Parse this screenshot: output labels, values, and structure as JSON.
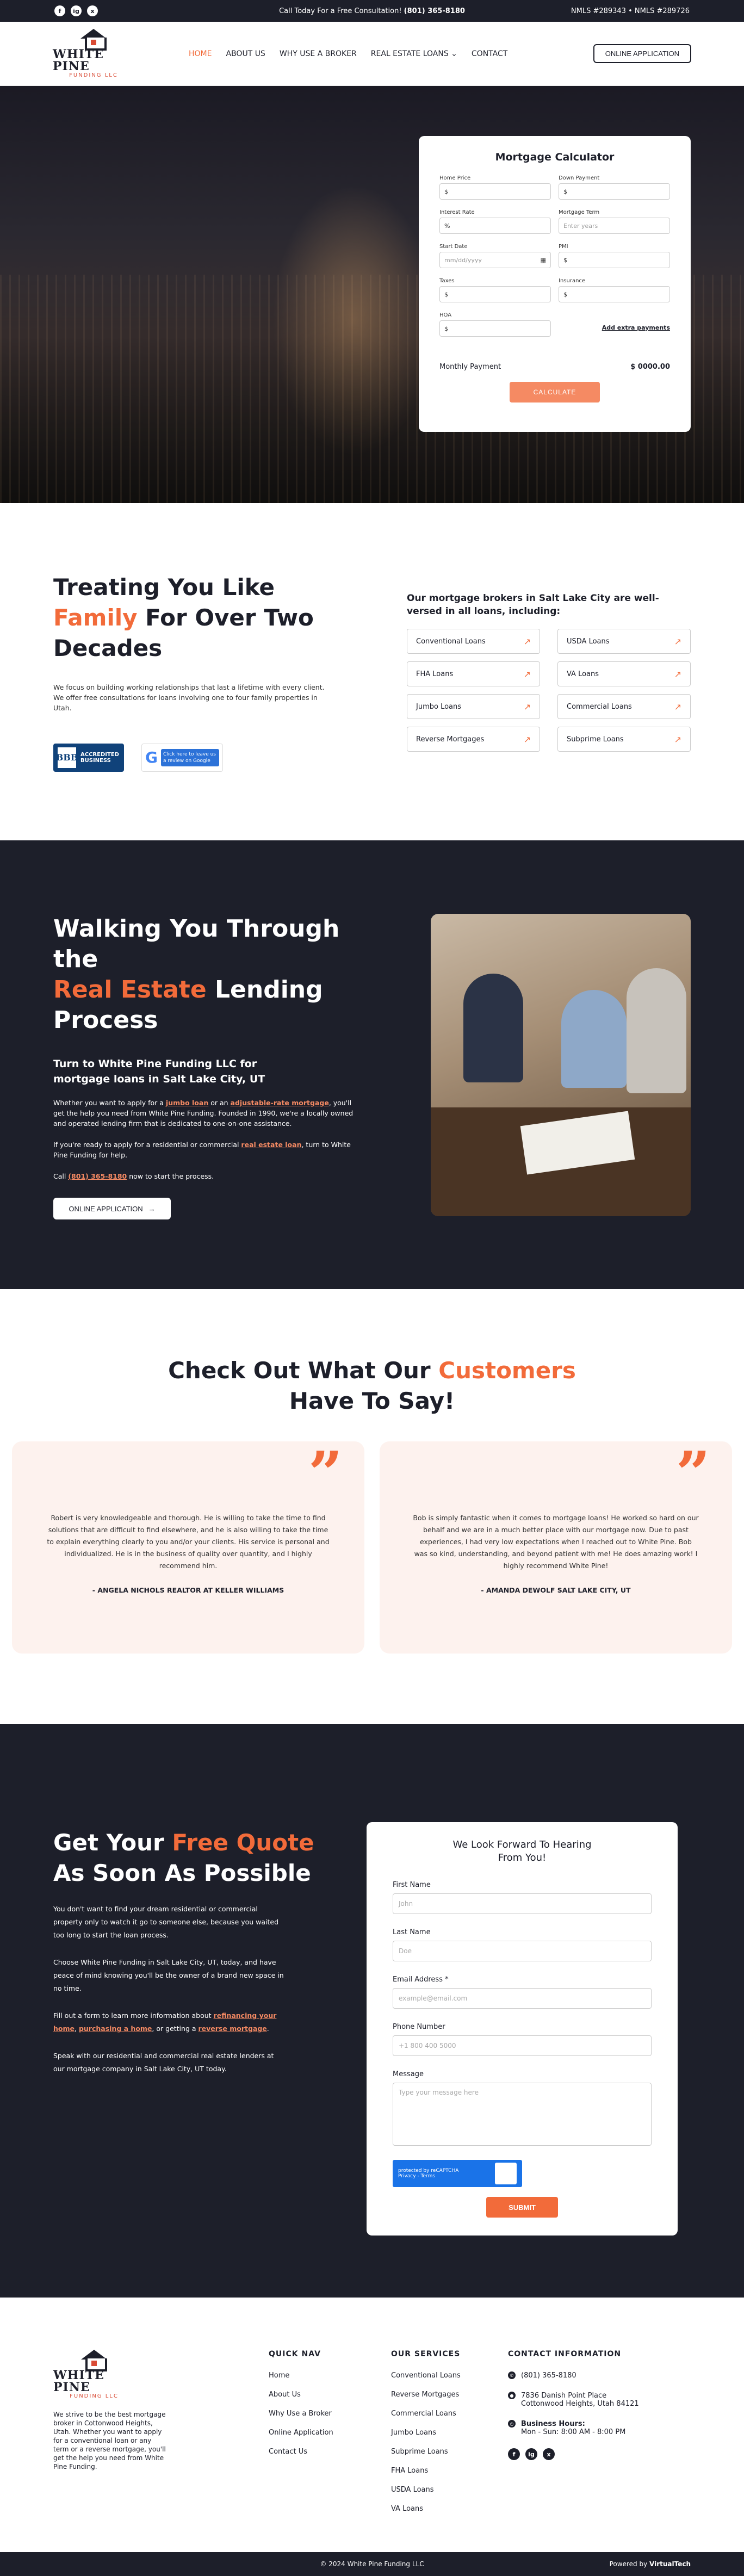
{
  "topbar": {
    "social": [
      "f",
      "ig",
      "x"
    ],
    "cta_prefix": "Call Today For a Free Consultation!",
    "phone": "(801) 365-8180",
    "nmls": "NMLS #289343 • NMLS #289726"
  },
  "header": {
    "logo_name": "WHITE PINE",
    "logo_sub": "FUNDING LLC",
    "nav": [
      "HOME",
      "ABOUT US",
      "WHY USE A BROKER",
      "REAL ESTATE LOANS",
      "CONTACT"
    ],
    "cta": "ONLINE APPLICATION"
  },
  "calculator": {
    "title": "Mortgage Calculator",
    "fields": [
      {
        "label": "Home Price",
        "value": "$"
      },
      {
        "label": "Down Payment",
        "value": "$"
      },
      {
        "label": "Interest Rate",
        "value": "%"
      },
      {
        "label": "Mortgage Term",
        "value": "Enter years"
      },
      {
        "label": "Start Date",
        "value": "mm/dd/yyyy"
      },
      {
        "label": "PMI",
        "value": "$"
      },
      {
        "label": "Taxes",
        "value": "$"
      },
      {
        "label": "Insurance",
        "value": "$"
      },
      {
        "label": "HOA",
        "value": "$"
      }
    ],
    "extra_link": "Add extra payments",
    "monthly_label": "Monthly Payment",
    "monthly_value": "$ 0000.00",
    "button": "CALCULATE"
  },
  "treating": {
    "title_1": "Treating You Like",
    "title_accent": "Family",
    "title_2": "For Over Two Decades",
    "body": "We focus on building working relationships that last a lifetime with every client. We offer free consultations for loans involving one to four family properties in Utah.",
    "bbb_text": "ACCREDITED BUSINESS",
    "google_text": "Click here to leave us a review on Google",
    "loans_title": "Our mortgage brokers in Salt Lake City are well-versed in all loans, including:",
    "loans": [
      "Conventional Loans",
      "USDA Loans",
      "FHA Loans",
      "VA Loans",
      "Jumbo Loans",
      "Commercial Loans",
      "Reverse Mortgages",
      "Subprime Loans"
    ]
  },
  "walking": {
    "title_1": "Walking You Through the",
    "title_accent": "Real Estate",
    "title_2": "Lending Process",
    "subtitle": "Turn to White Pine Funding LLC for mortgage loans in Salt Lake City, UT",
    "p1_a": "Whether you want to apply for a ",
    "p1_link1": "jumbo loan",
    "p1_b": " or an ",
    "p1_link2": "adjustable-rate mortgage",
    "p1_c": ", you'll get the help you need from White Pine Funding. Founded in 1990, we're a locally owned and operated lending firm that is dedicated to one-on-one assistance.",
    "p2_a": "If you're ready to apply for a residential or commercial ",
    "p2_link": "real estate loan",
    "p2_b": ", turn to White Pine Funding for help.",
    "p3_a": "Call ",
    "p3_link": "(801) 365-8180",
    "p3_b": " now to start the process.",
    "button": "ONLINE APPLICATION"
  },
  "testimonials": {
    "title_1": "Check Out What Our",
    "title_accent": "Customers",
    "title_2": "Have To Say!",
    "items": [
      {
        "text": "Robert is very knowledgeable and thorough. He is willing to take the time to find solutions that are difficult to find elsewhere, and he is also willing to take the time to explain everything clearly to you and/or your clients. His service is personal and individualized. He is in the business of quality over quantity, and I highly recommend him.",
        "author": "- ANGELA NICHOLS REALTOR AT KELLER WILLIAMS"
      },
      {
        "text": "Bob is simply fantastic when it comes to mortgage loans! He worked so hard on our behalf and we are in a much better place with our mortgage now. Due to past experiences, I had very low expectations when I reached out to White Pine. Bob was so kind, understanding, and beyond patient with me! He does amazing work! I highly recommend White Pine!",
        "author": "- AMANDA DEWOLF SALT LAKE CITY, UT"
      }
    ]
  },
  "quote": {
    "title_1": "Get Your",
    "title_accent": "Free Quote",
    "title_2": "As Soon As Possible",
    "p1": "You don't want to find your dream residential or commercial property only to watch it go to someone else, because you waited too long to start the loan process.",
    "p2": "Choose White Pine Funding in Salt Lake City, UT, today, and have peace of mind knowing you'll be the owner of a brand new space in no time.",
    "p3_a": "Fill out a form to learn more information about ",
    "p3_link1": "refinancing your home",
    "p3_b": ", ",
    "p3_link2": "purchasing a home",
    "p3_c": ", or getting a ",
    "p3_link3": "reverse mortgage",
    "p3_d": ".",
    "p4": "Speak with our residential and commercial real estate lenders at our mortgage company in Salt Lake City, UT today.",
    "form_title": "We Look Forward To Hearing From You!",
    "fields": [
      {
        "label": "First Name",
        "placeholder": "John"
      },
      {
        "label": "Last Name",
        "placeholder": "Doe"
      },
      {
        "label": "Email Address *",
        "placeholder": "example@email.com"
      },
      {
        "label": "Phone Number",
        "placeholder": "+1 800 400 5000"
      }
    ],
    "message_label": "Message",
    "message_placeholder": "Type your message here",
    "captcha": "protected by reCAPTCHA",
    "captcha_sub": "Privacy - Terms",
    "submit": "SUBMIT"
  },
  "footer": {
    "about": "We strive to be the best mortgage broker in Cottonwood Heights, Utah. Whether you want to apply for a conventional loan or any term or a reverse mortgage, you'll get the help you need from White Pine Funding.",
    "quicknav_title": "QUICK NAV",
    "quicknav": [
      "Home",
      "About Us",
      "Why Use a Broker",
      "Online Application",
      "Contact Us"
    ],
    "services_title": "OUR SERVICES",
    "services": [
      "Conventional Loans",
      "Reverse Mortgages",
      "Commercial Loans",
      "Jumbo Loans",
      "Subprime Loans",
      "FHA Loans",
      "USDA Loans",
      "VA Loans"
    ],
    "contact_title": "CONTACT INFORMATION",
    "phone": "(801) 365-8180",
    "address": "7836 Danish Point Place Cottonwood Heights, Utah 84121",
    "hours_title": "Business Hours:",
    "hours": "Mon - Sun: 8:00 AM - 8:00 PM",
    "copyright": "© 2024 White Pine Funding LLC",
    "powered_prefix": "Powered by",
    "powered_by": "VirtualTech"
  }
}
